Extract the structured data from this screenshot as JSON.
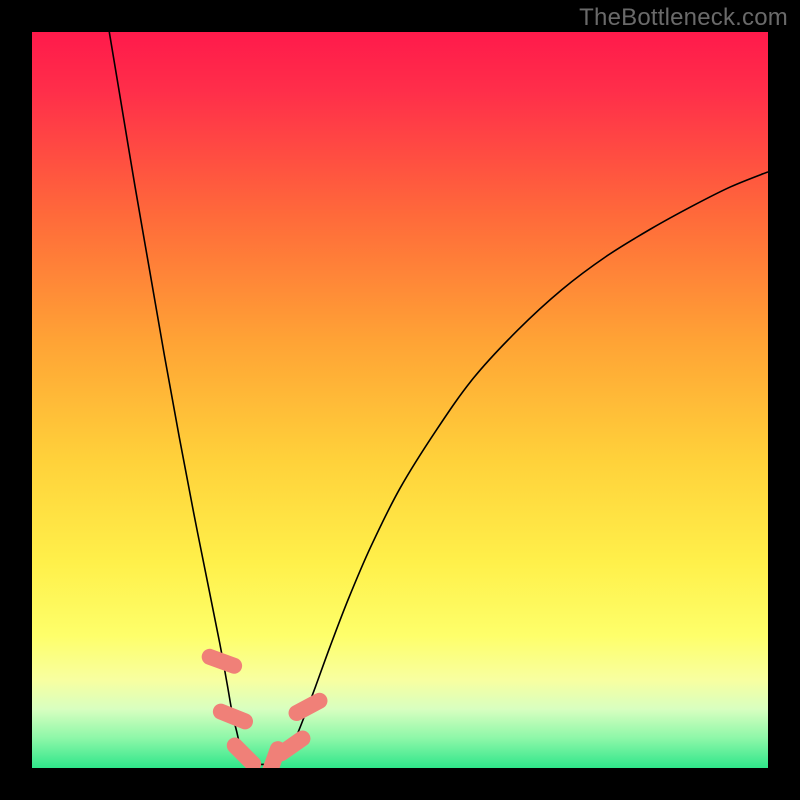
{
  "watermark": "TheBottleneck.com",
  "chart_data": {
    "type": "line",
    "title": "",
    "xlabel": "",
    "ylabel": "",
    "xlim": [
      0,
      100
    ],
    "ylim": [
      0,
      100
    ],
    "background_gradient": {
      "stops": [
        {
          "offset": 0.0,
          "color": "#ff1a4b"
        },
        {
          "offset": 0.08,
          "color": "#ff2e4a"
        },
        {
          "offset": 0.25,
          "color": "#ff6a3a"
        },
        {
          "offset": 0.42,
          "color": "#ffa335"
        },
        {
          "offset": 0.58,
          "color": "#ffd13a"
        },
        {
          "offset": 0.72,
          "color": "#fff04a"
        },
        {
          "offset": 0.82,
          "color": "#feff6a"
        },
        {
          "offset": 0.88,
          "color": "#f8ffa0"
        },
        {
          "offset": 0.92,
          "color": "#d8ffc0"
        },
        {
          "offset": 0.96,
          "color": "#8cf7a8"
        },
        {
          "offset": 1.0,
          "color": "#2fe68a"
        }
      ]
    },
    "series": [
      {
        "name": "curve",
        "color": "#000000",
        "stroke_width": 1.6,
        "points_xy": [
          [
            10.5,
            100.0
          ],
          [
            12.0,
            91.0
          ],
          [
            14.0,
            79.0
          ],
          [
            16.0,
            67.5
          ],
          [
            18.0,
            56.0
          ],
          [
            20.0,
            45.0
          ],
          [
            22.0,
            34.5
          ],
          [
            24.0,
            24.5
          ],
          [
            25.5,
            17.0
          ],
          [
            26.5,
            11.5
          ],
          [
            27.2,
            7.5
          ],
          [
            27.8,
            5.0
          ],
          [
            28.3,
            3.0
          ],
          [
            29.0,
            1.6
          ],
          [
            30.0,
            0.8
          ],
          [
            31.0,
            0.5
          ],
          [
            32.5,
            0.6
          ],
          [
            33.8,
            1.2
          ],
          [
            35.0,
            2.5
          ],
          [
            36.0,
            4.5
          ],
          [
            37.0,
            7.0
          ],
          [
            38.5,
            11.0
          ],
          [
            40.5,
            16.5
          ],
          [
            43.0,
            23.0
          ],
          [
            46.0,
            30.0
          ],
          [
            50.0,
            38.0
          ],
          [
            55.0,
            46.0
          ],
          [
            60.0,
            53.0
          ],
          [
            66.0,
            59.5
          ],
          [
            72.0,
            65.0
          ],
          [
            78.0,
            69.5
          ],
          [
            84.0,
            73.2
          ],
          [
            90.0,
            76.5
          ],
          [
            95.0,
            79.0
          ],
          [
            100.0,
            81.0
          ]
        ]
      }
    ],
    "markers": {
      "color": "#f08078",
      "stroke": "#c85a52",
      "points_xy": [
        {
          "x": 25.8,
          "y": 14.5,
          "angle": -70
        },
        {
          "x": 27.3,
          "y": 7.0,
          "angle": -68
        },
        {
          "x": 28.8,
          "y": 1.8,
          "angle": -45
        },
        {
          "x": 32.8,
          "y": 0.9,
          "angle": 20
        },
        {
          "x": 35.3,
          "y": 3.0,
          "angle": 55
        },
        {
          "x": 37.5,
          "y": 8.3,
          "angle": 62
        }
      ]
    }
  }
}
